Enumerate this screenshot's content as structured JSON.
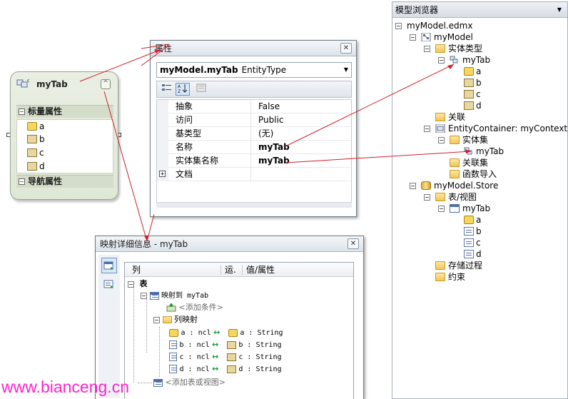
{
  "entity": {
    "title": "myTab",
    "collapse_glyph": "^",
    "scalar_header": "标量属性",
    "nav_header": "导航属性",
    "properties": [
      {
        "name": "a",
        "icon": "key-icon"
      },
      {
        "name": "b",
        "icon": "property-icon"
      },
      {
        "name": "c",
        "icon": "property-icon"
      },
      {
        "name": "d",
        "icon": "property-icon"
      }
    ]
  },
  "properties_window": {
    "title": "属性",
    "object_name": "myModel.myTab",
    "object_type": "EntityType",
    "rows": [
      {
        "key": "抽象",
        "value": "False",
        "bold": false
      },
      {
        "key": "访问",
        "value": "Public",
        "bold": false
      },
      {
        "key": "基类型",
        "value": "(无)",
        "bold": false
      },
      {
        "key": "名称",
        "value": "myTab",
        "bold": true
      },
      {
        "key": "实体集名称",
        "value": "myTab",
        "bold": true
      },
      {
        "key": "文档",
        "value": "",
        "bold": false
      }
    ]
  },
  "mapping_window": {
    "title": "映射详细信息 - myTab",
    "columns": [
      "列",
      "运.",
      "值/属性"
    ],
    "table_node": "表",
    "maps_to": "映射到 myTab",
    "add_condition": "<添加条件>",
    "column_mappings_label": "列映射",
    "mappings": [
      {
        "column": "a : ncl",
        "property": "a : String",
        "key": true
      },
      {
        "column": "b : ncl",
        "property": "b : String",
        "key": false
      },
      {
        "column": "c : ncl",
        "property": "c : String",
        "key": false
      },
      {
        "column": "d : ncl",
        "property": "d : String",
        "key": false
      }
    ],
    "add_table": "<添加表或视图>"
  },
  "model_browser": {
    "title": "模型浏览器",
    "nodes": {
      "root": "myModel.edmx",
      "model": "myModel",
      "entity_types": "实体类型",
      "entity_mytab": "myTab",
      "props": [
        "a",
        "b",
        "c",
        "d"
      ],
      "associations": "关联",
      "container": "EntityContainer: myContext",
      "entity_sets": "实体集",
      "entity_set_mytab": "myTab",
      "association_sets": "关联集",
      "function_imports": "函数导入",
      "store": "myModel.Store",
      "tables_views": "表/视图",
      "store_mytab": "myTab",
      "store_cols": [
        "a",
        "b",
        "c",
        "d"
      ],
      "stored_procs": "存储过程",
      "constraints": "约束"
    }
  },
  "watermark": "www.bianceng.cn",
  "colors": {
    "annotation_line": "#d0202a",
    "watermark": "#ff22cc",
    "entity_fill": "#e3eadb"
  }
}
